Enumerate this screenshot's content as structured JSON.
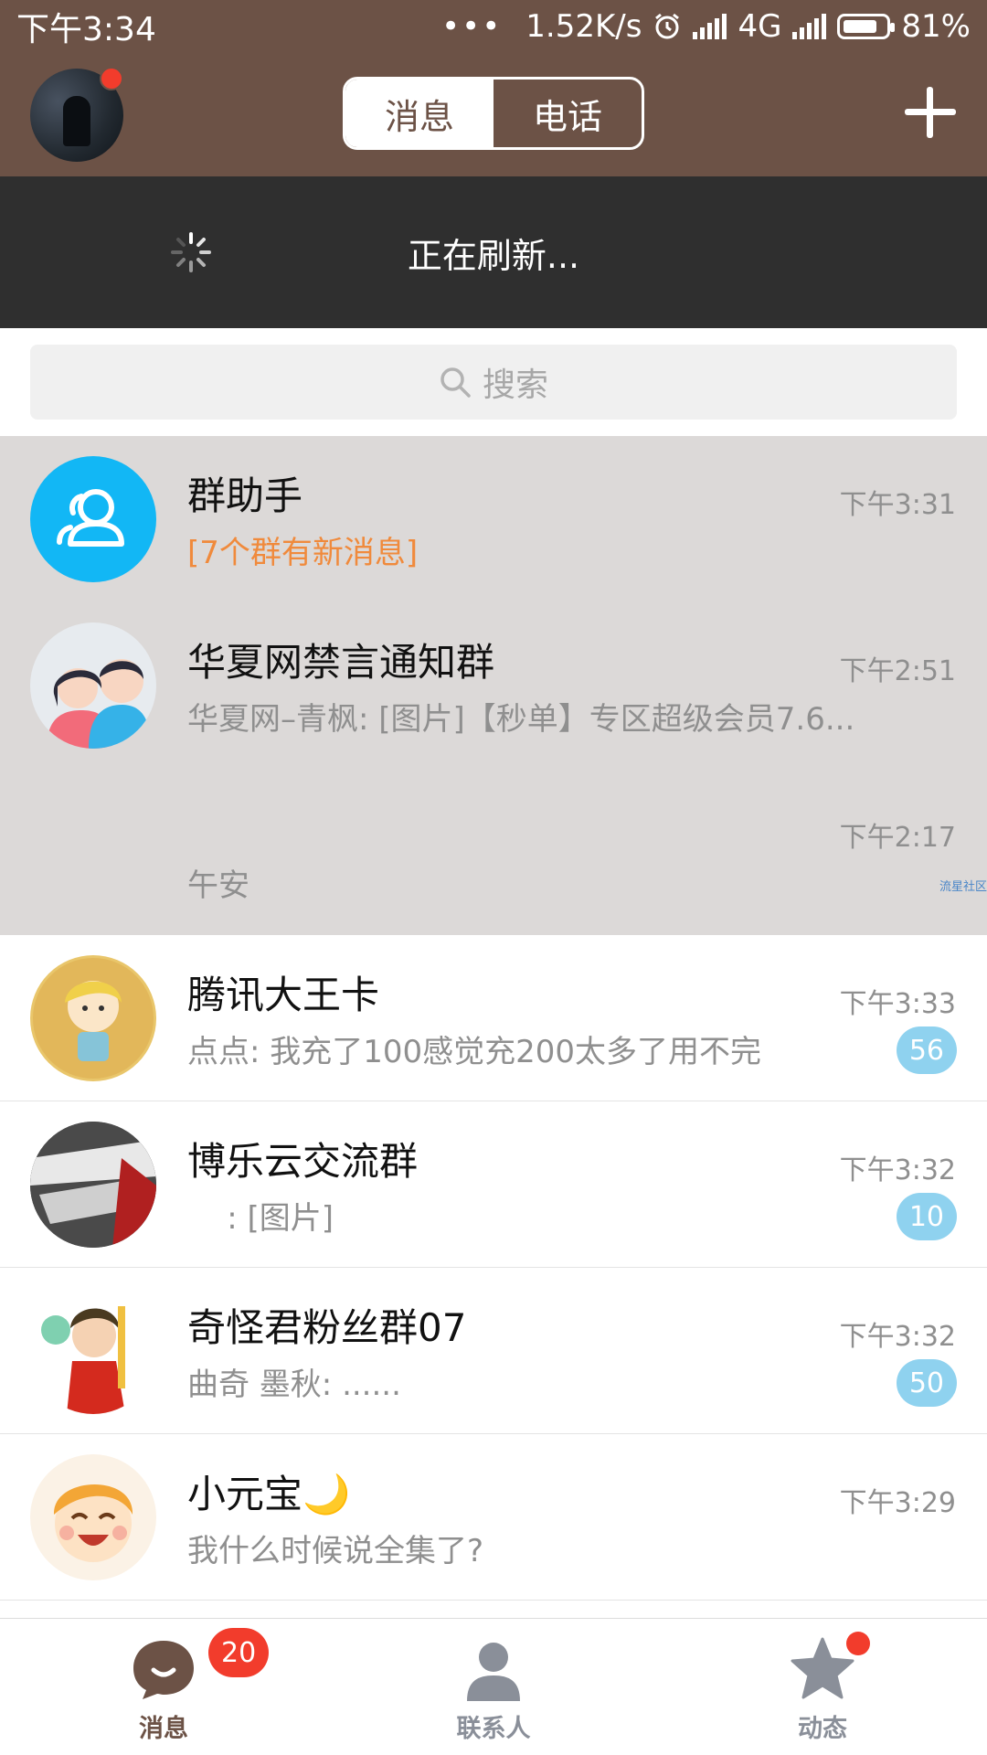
{
  "status_bar": {
    "time": "下午3:34",
    "dots": "•••",
    "speed": "1.52K/s",
    "network": "4G",
    "battery": "81%"
  },
  "header": {
    "tabs": [
      {
        "label": "消息",
        "active": true
      },
      {
        "label": "电话",
        "active": false
      }
    ]
  },
  "refresh": {
    "text": "正在刷新..."
  },
  "search": {
    "placeholder": "搜索"
  },
  "conversations": [
    {
      "name": "群助手",
      "preview": "[7个群有新消息]",
      "time": "下午3:31",
      "pinned": true
    },
    {
      "name": "华夏网禁言通知群",
      "preview": "华夏网–青枫: [图片]【秒单】专区超级会员7.6...",
      "time": "下午2:51",
      "pinned": true
    },
    {
      "name": "",
      "preview": "午安",
      "time": "下午2:17",
      "pinned": true,
      "watermark": "流星社区"
    },
    {
      "name": "腾讯大王卡",
      "preview": "点点: 我充了100感觉充200太多了用不完",
      "time": "下午3:33",
      "badge": "56"
    },
    {
      "name": "博乐云交流群",
      "preview": "    : [图片]",
      "time": "下午3:32",
      "badge": "10"
    },
    {
      "name": "奇怪君粉丝群07",
      "preview": "曲奇 墨秋: ......",
      "time": "下午3:32",
      "badge": "50"
    },
    {
      "name": "小元宝🌙",
      "preview": "我什么时候说全集了?",
      "time": "下午3:29"
    }
  ],
  "bottom_nav": {
    "items": [
      {
        "label": "消息",
        "badge": "20",
        "color": "#6c5246"
      },
      {
        "label": "联系人",
        "color": "#8a8f99"
      },
      {
        "label": "动态",
        "color": "#8a8f99"
      }
    ]
  },
  "colors": {
    "brand_brown": "#6c5246",
    "refresh_bg": "#2f2f2f",
    "pinned_bg": "#dcd9d8",
    "badge_blue": "#8fd2ef",
    "alert_red": "#f23c2c",
    "highlight_orange": "#f08a3c"
  }
}
